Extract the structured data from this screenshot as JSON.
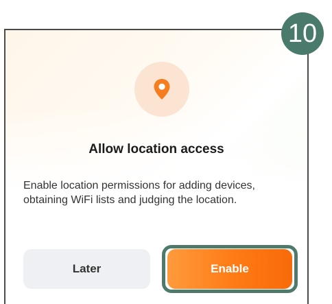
{
  "dialog": {
    "title": "Allow location access",
    "message": "Enable location permissions for adding devices, obtaining WiFi lists and judging the location.",
    "icon": "location-pin-icon",
    "later_label": "Later",
    "enable_label": "Enable"
  },
  "step_badge": "10",
  "colors": {
    "accent": "#ff7a14",
    "badge": "#4a7a6b",
    "icon_bg": "#fbe4d2",
    "later_bg": "#eef0f3"
  }
}
